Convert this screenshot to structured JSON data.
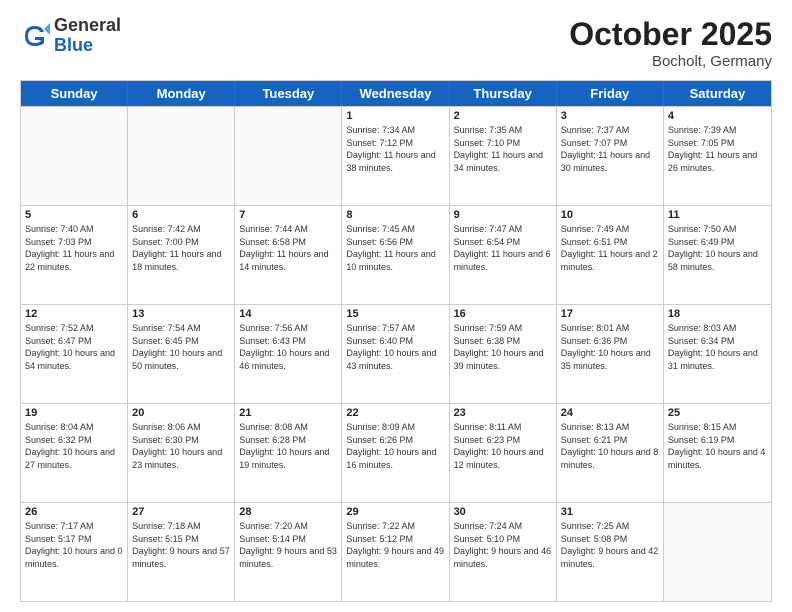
{
  "header": {
    "logo_general": "General",
    "logo_blue": "Blue",
    "month_title": "October 2025",
    "location": "Bocholt, Germany"
  },
  "days_of_week": [
    "Sunday",
    "Monday",
    "Tuesday",
    "Wednesday",
    "Thursday",
    "Friday",
    "Saturday"
  ],
  "rows": [
    {
      "cells": [
        {
          "day": "",
          "info": ""
        },
        {
          "day": "",
          "info": ""
        },
        {
          "day": "",
          "info": ""
        },
        {
          "day": "1",
          "info": "Sunrise: 7:34 AM\nSunset: 7:12 PM\nDaylight: 11 hours\nand 38 minutes."
        },
        {
          "day": "2",
          "info": "Sunrise: 7:35 AM\nSunset: 7:10 PM\nDaylight: 11 hours\nand 34 minutes."
        },
        {
          "day": "3",
          "info": "Sunrise: 7:37 AM\nSunset: 7:07 PM\nDaylight: 11 hours\nand 30 minutes."
        },
        {
          "day": "4",
          "info": "Sunrise: 7:39 AM\nSunset: 7:05 PM\nDaylight: 11 hours\nand 26 minutes."
        }
      ]
    },
    {
      "cells": [
        {
          "day": "5",
          "info": "Sunrise: 7:40 AM\nSunset: 7:03 PM\nDaylight: 11 hours\nand 22 minutes."
        },
        {
          "day": "6",
          "info": "Sunrise: 7:42 AM\nSunset: 7:00 PM\nDaylight: 11 hours\nand 18 minutes."
        },
        {
          "day": "7",
          "info": "Sunrise: 7:44 AM\nSunset: 6:58 PM\nDaylight: 11 hours\nand 14 minutes."
        },
        {
          "day": "8",
          "info": "Sunrise: 7:45 AM\nSunset: 6:56 PM\nDaylight: 11 hours\nand 10 minutes."
        },
        {
          "day": "9",
          "info": "Sunrise: 7:47 AM\nSunset: 6:54 PM\nDaylight: 11 hours\nand 6 minutes."
        },
        {
          "day": "10",
          "info": "Sunrise: 7:49 AM\nSunset: 6:51 PM\nDaylight: 11 hours\nand 2 minutes."
        },
        {
          "day": "11",
          "info": "Sunrise: 7:50 AM\nSunset: 6:49 PM\nDaylight: 10 hours\nand 58 minutes."
        }
      ]
    },
    {
      "cells": [
        {
          "day": "12",
          "info": "Sunrise: 7:52 AM\nSunset: 6:47 PM\nDaylight: 10 hours\nand 54 minutes."
        },
        {
          "day": "13",
          "info": "Sunrise: 7:54 AM\nSunset: 6:45 PM\nDaylight: 10 hours\nand 50 minutes."
        },
        {
          "day": "14",
          "info": "Sunrise: 7:56 AM\nSunset: 6:43 PM\nDaylight: 10 hours\nand 46 minutes."
        },
        {
          "day": "15",
          "info": "Sunrise: 7:57 AM\nSunset: 6:40 PM\nDaylight: 10 hours\nand 43 minutes."
        },
        {
          "day": "16",
          "info": "Sunrise: 7:59 AM\nSunset: 6:38 PM\nDaylight: 10 hours\nand 39 minutes."
        },
        {
          "day": "17",
          "info": "Sunrise: 8:01 AM\nSunset: 6:36 PM\nDaylight: 10 hours\nand 35 minutes."
        },
        {
          "day": "18",
          "info": "Sunrise: 8:03 AM\nSunset: 6:34 PM\nDaylight: 10 hours\nand 31 minutes."
        }
      ]
    },
    {
      "cells": [
        {
          "day": "19",
          "info": "Sunrise: 8:04 AM\nSunset: 6:32 PM\nDaylight: 10 hours\nand 27 minutes."
        },
        {
          "day": "20",
          "info": "Sunrise: 8:06 AM\nSunset: 6:30 PM\nDaylight: 10 hours\nand 23 minutes."
        },
        {
          "day": "21",
          "info": "Sunrise: 8:08 AM\nSunset: 6:28 PM\nDaylight: 10 hours\nand 19 minutes."
        },
        {
          "day": "22",
          "info": "Sunrise: 8:09 AM\nSunset: 6:26 PM\nDaylight: 10 hours\nand 16 minutes."
        },
        {
          "day": "23",
          "info": "Sunrise: 8:11 AM\nSunset: 6:23 PM\nDaylight: 10 hours\nand 12 minutes."
        },
        {
          "day": "24",
          "info": "Sunrise: 8:13 AM\nSunset: 6:21 PM\nDaylight: 10 hours\nand 8 minutes."
        },
        {
          "day": "25",
          "info": "Sunrise: 8:15 AM\nSunset: 6:19 PM\nDaylight: 10 hours\nand 4 minutes."
        }
      ]
    },
    {
      "cells": [
        {
          "day": "26",
          "info": "Sunrise: 7:17 AM\nSunset: 5:17 PM\nDaylight: 10 hours\nand 0 minutes."
        },
        {
          "day": "27",
          "info": "Sunrise: 7:18 AM\nSunset: 5:15 PM\nDaylight: 9 hours\nand 57 minutes."
        },
        {
          "day": "28",
          "info": "Sunrise: 7:20 AM\nSunset: 5:14 PM\nDaylight: 9 hours\nand 53 minutes."
        },
        {
          "day": "29",
          "info": "Sunrise: 7:22 AM\nSunset: 5:12 PM\nDaylight: 9 hours\nand 49 minutes."
        },
        {
          "day": "30",
          "info": "Sunrise: 7:24 AM\nSunset: 5:10 PM\nDaylight: 9 hours\nand 46 minutes."
        },
        {
          "day": "31",
          "info": "Sunrise: 7:25 AM\nSunset: 5:08 PM\nDaylight: 9 hours\nand 42 minutes."
        },
        {
          "day": "",
          "info": ""
        }
      ]
    }
  ]
}
